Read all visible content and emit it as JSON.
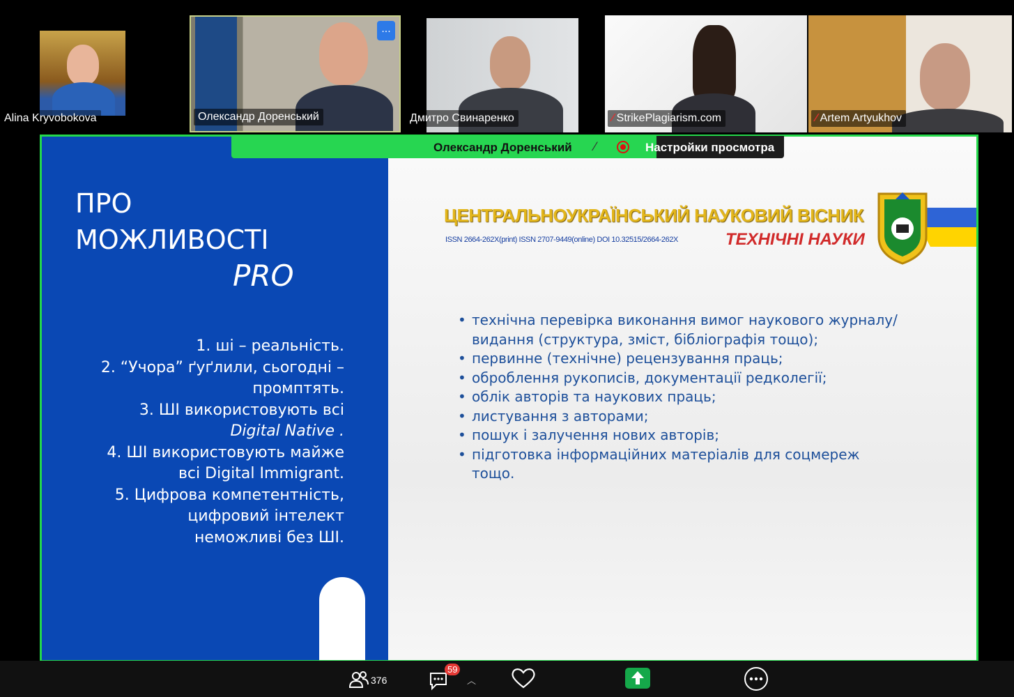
{
  "participants": [
    {
      "name": "Alina Kryvobokova",
      "muted": false
    },
    {
      "name": "Олександр Доренський",
      "muted": false,
      "more_label": "..."
    },
    {
      "name": "Дмитро Свинаренко",
      "muted": false
    },
    {
      "name": "StrikePlagiarism.com",
      "muted": true
    },
    {
      "name": "Artem Artyukhov",
      "muted": true
    }
  ],
  "speaker_bar": {
    "speaker_name": "Олександр Доренський",
    "view_settings_label": "Настройки просмотра"
  },
  "slide": {
    "title_line1": "ПРО",
    "title_line2": "МОЖЛИВОСТІ",
    "title_line3": "PRO",
    "points": [
      "1. ші – реальність.",
      "2. “Учора” ґуґлили, сьогодні –",
      "промптять.",
      "3. ШІ використовують всі",
      "Digital Native .",
      "4. ШІ використовують майже",
      "всі Digital Immigrant.",
      "5. Цифрова компетентність,",
      "цифровий інтелект",
      "неможливі без ШІ."
    ],
    "journal_title": "ЦЕНТРАЛЬНОУКРАЇНСЬКИЙ НАУКОВИЙ ВІСНИК",
    "journal_issn": "ISSN 2664-262X(print) ISSN 2707-9449(online) DOI 10.32515/2664-262X",
    "journal_subject": "ТЕХНІЧНІ НАУКИ",
    "bullets": [
      "технічна перевірка виконання вимог наукового журналу/ видання (структура, зміст, бібліографія тощо);",
      "первинне (технічне) рецензування праць;",
      "оброблення рукописів, документації редколегії;",
      "облік авторів та наукових праць;",
      "листування з авторами;",
      "пошук і залучення нових авторів;",
      "підготовка інформаційних матеріалів для соцмереж тощо."
    ]
  },
  "toolbar": {
    "participants_count": "376",
    "chat_badge": "59"
  },
  "colors": {
    "active_speaker": "#24d84a",
    "slide_blue": "#0a48b4",
    "bullet_text": "#1d4f9a",
    "journal_gold": "#e3b61b",
    "subject_red": "#d12a2a"
  }
}
